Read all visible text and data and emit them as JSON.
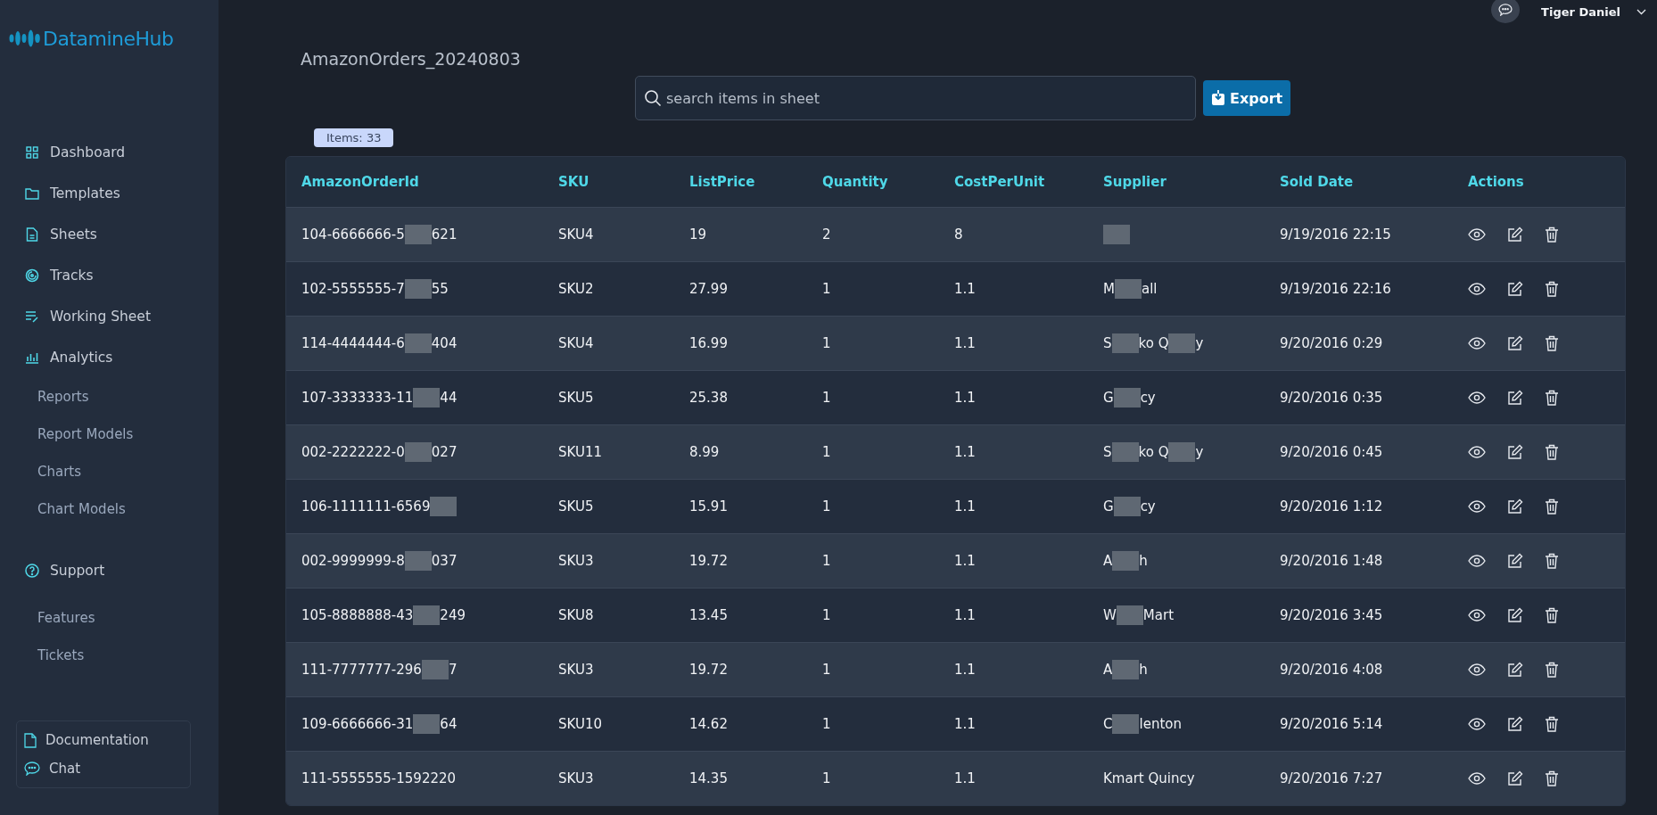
{
  "sidebar": {
    "logo": "DatamineHub",
    "items": [
      {
        "label": "Dashboard",
        "kind": "main"
      },
      {
        "label": "Templates",
        "kind": "main"
      },
      {
        "label": "Sheets",
        "kind": "main"
      },
      {
        "label": "Tracks",
        "kind": "main"
      },
      {
        "label": "Working Sheet",
        "kind": "main"
      },
      {
        "label": "Analytics",
        "kind": "main"
      },
      {
        "label": "Reports",
        "kind": "sub"
      },
      {
        "label": "Report Models",
        "kind": "sub"
      },
      {
        "label": "Charts",
        "kind": "sub"
      },
      {
        "label": "Chart Models",
        "kind": "sub"
      },
      {
        "label": "Support",
        "kind": "main"
      },
      {
        "label": "Features",
        "kind": "sub"
      },
      {
        "label": "Tickets",
        "kind": "sub"
      }
    ],
    "footer_links": [
      "Documentation",
      "Chat"
    ]
  },
  "user": {
    "name": "Tiger Daniel"
  },
  "sheet_title": "AmazonOrders_20240803",
  "search": {
    "placeholder": "search items in sheet"
  },
  "export_button": "Export",
  "items_badge": "Items: 33",
  "table": {
    "columns": [
      "AmazonOrderId",
      "SKU",
      "ListPrice",
      "Quantity",
      "CostPerUnit",
      "Supplier",
      "Sold Date",
      "Actions"
    ],
    "rows": [
      {
        "order_id": [
          {
            "kind": "text",
            "text": "104-6666666-5"
          },
          {
            "kind": "redacted"
          },
          {
            "kind": "text",
            "text": "621"
          }
        ],
        "sku": "SKU4",
        "list_price": "19",
        "quantity": "2",
        "cost_per_unit": "8",
        "supplier": [
          {
            "kind": "redacted"
          }
        ],
        "sold_date": "9/19/2016 22:15"
      },
      {
        "order_id": [
          {
            "kind": "text",
            "text": "102-5555555-7"
          },
          {
            "kind": "redacted"
          },
          {
            "kind": "text",
            "text": "55"
          }
        ],
        "sku": "SKU2",
        "list_price": "27.99",
        "quantity": "1",
        "cost_per_unit": "1.1",
        "supplier": [
          {
            "kind": "text",
            "text": "M"
          },
          {
            "kind": "redacted"
          },
          {
            "kind": "text",
            "text": "all"
          }
        ],
        "sold_date": "9/19/2016 22:16"
      },
      {
        "order_id": [
          {
            "kind": "text",
            "text": "114-4444444-6"
          },
          {
            "kind": "redacted"
          },
          {
            "kind": "text",
            "text": "404"
          }
        ],
        "sku": "SKU4",
        "list_price": "16.99",
        "quantity": "1",
        "cost_per_unit": "1.1",
        "supplier": [
          {
            "kind": "text",
            "text": "S"
          },
          {
            "kind": "redacted"
          },
          {
            "kind": "text",
            "text": "ko Q"
          },
          {
            "kind": "redacted"
          },
          {
            "kind": "text",
            "text": "y"
          }
        ],
        "sold_date": "9/20/2016 0:29"
      },
      {
        "order_id": [
          {
            "kind": "text",
            "text": "107-3333333-11"
          },
          {
            "kind": "redacted"
          },
          {
            "kind": "text",
            "text": "44"
          }
        ],
        "sku": "SKU5",
        "list_price": "25.38",
        "quantity": "1",
        "cost_per_unit": "1.1",
        "supplier": [
          {
            "kind": "text",
            "text": "G"
          },
          {
            "kind": "redacted"
          },
          {
            "kind": "text",
            "text": "cy"
          }
        ],
        "sold_date": "9/20/2016 0:35"
      },
      {
        "order_id": [
          {
            "kind": "text",
            "text": "002-2222222-0"
          },
          {
            "kind": "redacted"
          },
          {
            "kind": "text",
            "text": "027"
          }
        ],
        "sku": "SKU11",
        "list_price": "8.99",
        "quantity": "1",
        "cost_per_unit": "1.1",
        "supplier": [
          {
            "kind": "text",
            "text": "S"
          },
          {
            "kind": "redacted"
          },
          {
            "kind": "text",
            "text": "ko Q"
          },
          {
            "kind": "redacted"
          },
          {
            "kind": "text",
            "text": "y"
          }
        ],
        "sold_date": "9/20/2016 0:45"
      },
      {
        "order_id": [
          {
            "kind": "text",
            "text": "106-1111111-6569"
          },
          {
            "kind": "redacted"
          }
        ],
        "sku": "SKU5",
        "list_price": "15.91",
        "quantity": "1",
        "cost_per_unit": "1.1",
        "supplier": [
          {
            "kind": "text",
            "text": "G"
          },
          {
            "kind": "redacted"
          },
          {
            "kind": "text",
            "text": "cy"
          }
        ],
        "sold_date": "9/20/2016 1:12"
      },
      {
        "order_id": [
          {
            "kind": "text",
            "text": "002-9999999-8"
          },
          {
            "kind": "redacted"
          },
          {
            "kind": "text",
            "text": "037"
          }
        ],
        "sku": "SKU3",
        "list_price": "19.72",
        "quantity": "1",
        "cost_per_unit": "1.1",
        "supplier": [
          {
            "kind": "text",
            "text": "A"
          },
          {
            "kind": "redacted"
          },
          {
            "kind": "text",
            "text": "h"
          }
        ],
        "sold_date": "9/20/2016 1:48"
      },
      {
        "order_id": [
          {
            "kind": "text",
            "text": "105-8888888-43"
          },
          {
            "kind": "redacted"
          },
          {
            "kind": "text",
            "text": "249"
          }
        ],
        "sku": "SKU8",
        "list_price": "13.45",
        "quantity": "1",
        "cost_per_unit": "1.1",
        "supplier": [
          {
            "kind": "text",
            "text": "W"
          },
          {
            "kind": "redacted"
          },
          {
            "kind": "text",
            "text": "Mart"
          }
        ],
        "sold_date": "9/20/2016 3:45"
      },
      {
        "order_id": [
          {
            "kind": "text",
            "text": "111-7777777-296"
          },
          {
            "kind": "redacted"
          },
          {
            "kind": "text",
            "text": "7"
          }
        ],
        "sku": "SKU3",
        "list_price": "19.72",
        "quantity": "1",
        "cost_per_unit": "1.1",
        "supplier": [
          {
            "kind": "text",
            "text": "A"
          },
          {
            "kind": "redacted"
          },
          {
            "kind": "text",
            "text": "h"
          }
        ],
        "sold_date": "9/20/2016 4:08"
      },
      {
        "order_id": [
          {
            "kind": "text",
            "text": "109-6666666-31"
          },
          {
            "kind": "redacted"
          },
          {
            "kind": "text",
            "text": "64"
          }
        ],
        "sku": "SKU10",
        "list_price": "14.62",
        "quantity": "1",
        "cost_per_unit": "1.1",
        "supplier": [
          {
            "kind": "text",
            "text": "C"
          },
          {
            "kind": "redacted"
          },
          {
            "kind": "text",
            "text": "lenton"
          }
        ],
        "sold_date": "9/20/2016 5:14"
      },
      {
        "order_id": [
          {
            "kind": "text",
            "text": "111-5555555-1592220"
          }
        ],
        "sku": "SKU3",
        "list_price": "14.35",
        "quantity": "1",
        "cost_per_unit": "1.1",
        "supplier": [
          {
            "kind": "text",
            "text": "Kmart Quincy"
          }
        ],
        "sold_date": "9/20/2016 7:27"
      }
    ]
  }
}
